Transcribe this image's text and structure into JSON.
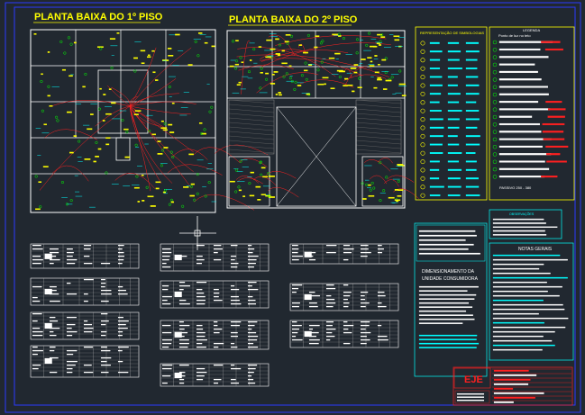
{
  "drawing": {
    "floor1_title": "PLANTA BAIXA DO 1º PISO",
    "floor2_title": "PLANTA BAIXA DO 2º PISO"
  },
  "symbols_panel": {
    "title": "REPRESENTAÇÃO DE SIMBOLOGIAS"
  },
  "legend_panel": {
    "title": "LEGENDA",
    "first_item": "Ponto de luz no teto",
    "bottom_note": "PASSIVO 250 - 380"
  },
  "dimensioning": {
    "title_line1": "DIMENSIONAMENTO DA",
    "title_line2": "UNIDADE CONSUMIDORA"
  },
  "notes": {
    "title": "NOTAS GERAIS",
    "upper_title": "OBSERVAÇÕES"
  },
  "titleblock": {
    "logo_text": "EJE"
  },
  "colors": {
    "background": "#212830",
    "title_text": "#ffff00",
    "wall": "#ffffff",
    "wiring": "#ff2020",
    "annotation": "#00ffff",
    "symbol": "#ffff00",
    "border": "#2a3aff",
    "green": "#00ff00"
  }
}
